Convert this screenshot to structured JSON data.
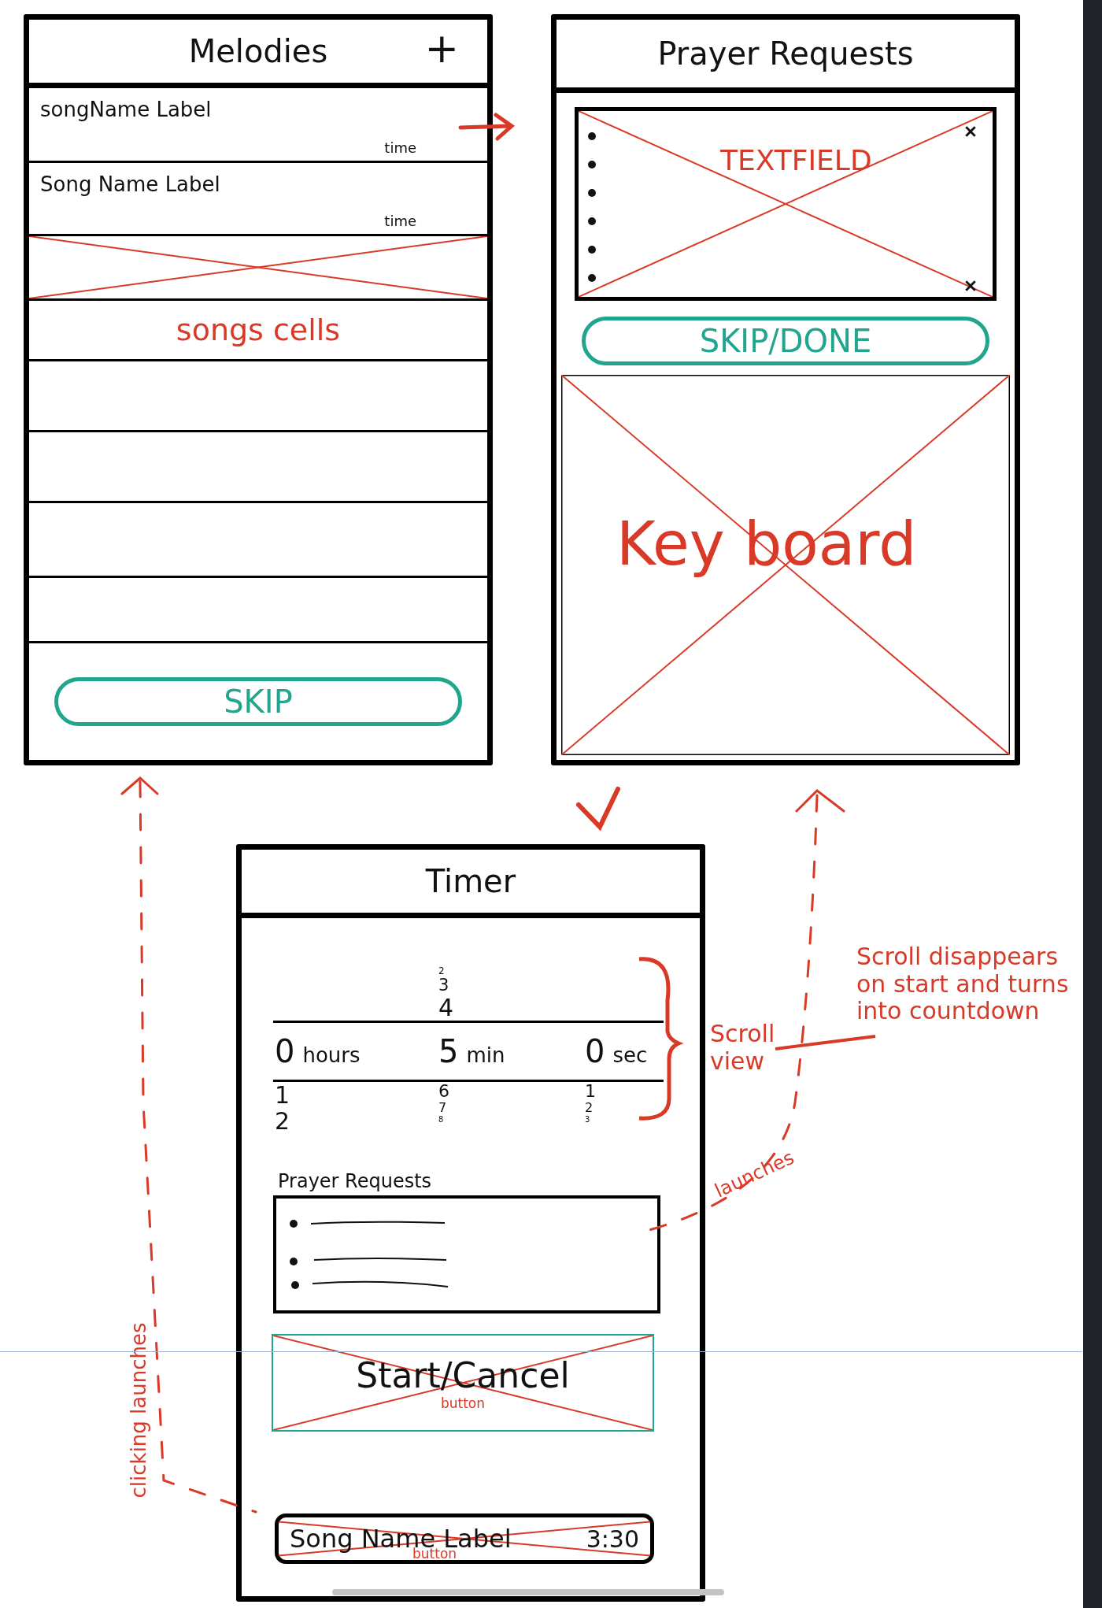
{
  "melodies_screen": {
    "title": "Melodies",
    "add_button": "+",
    "rows": [
      {
        "kind": "song",
        "name": "songName Label",
        "time": "time"
      },
      {
        "kind": "song",
        "name": "Song Name Label",
        "time": "time"
      },
      {
        "kind": "placeholder"
      },
      {
        "kind": "note",
        "text": "songs cells"
      },
      {
        "kind": "empty"
      },
      {
        "kind": "empty"
      },
      {
        "kind": "empty"
      },
      {
        "kind": "empty"
      }
    ],
    "button": "SKIP"
  },
  "prayer_requests_screen": {
    "title": "Prayer Requests",
    "text_field_note": "TEXTFIELD",
    "button": "SKIP/DONE",
    "keyboard_note": "Key board"
  },
  "timer_screen": {
    "title": "Timer",
    "picker": [
      {
        "value": "0",
        "unit": "hours",
        "below": [
          "1",
          "2"
        ]
      },
      {
        "above": [
          "2",
          "3",
          "4"
        ],
        "value": "5",
        "unit": "min",
        "below": [
          "6",
          "7",
          "8"
        ]
      },
      {
        "value": "0",
        "unit": "sec",
        "below": [
          "1",
          "2",
          "3"
        ]
      }
    ],
    "prayer_label": "Prayer Requests",
    "start_button": "Start/Cancel",
    "start_note": "button",
    "song_button": {
      "name": "Song Name Label",
      "time": "3:30",
      "note": "button"
    }
  },
  "annotations": [
    {
      "text": "Scroll view"
    },
    {
      "text": "Scroll disappears on start and turns into countdown"
    },
    {
      "text": "launches"
    },
    {
      "text": "clicking launches"
    }
  ]
}
